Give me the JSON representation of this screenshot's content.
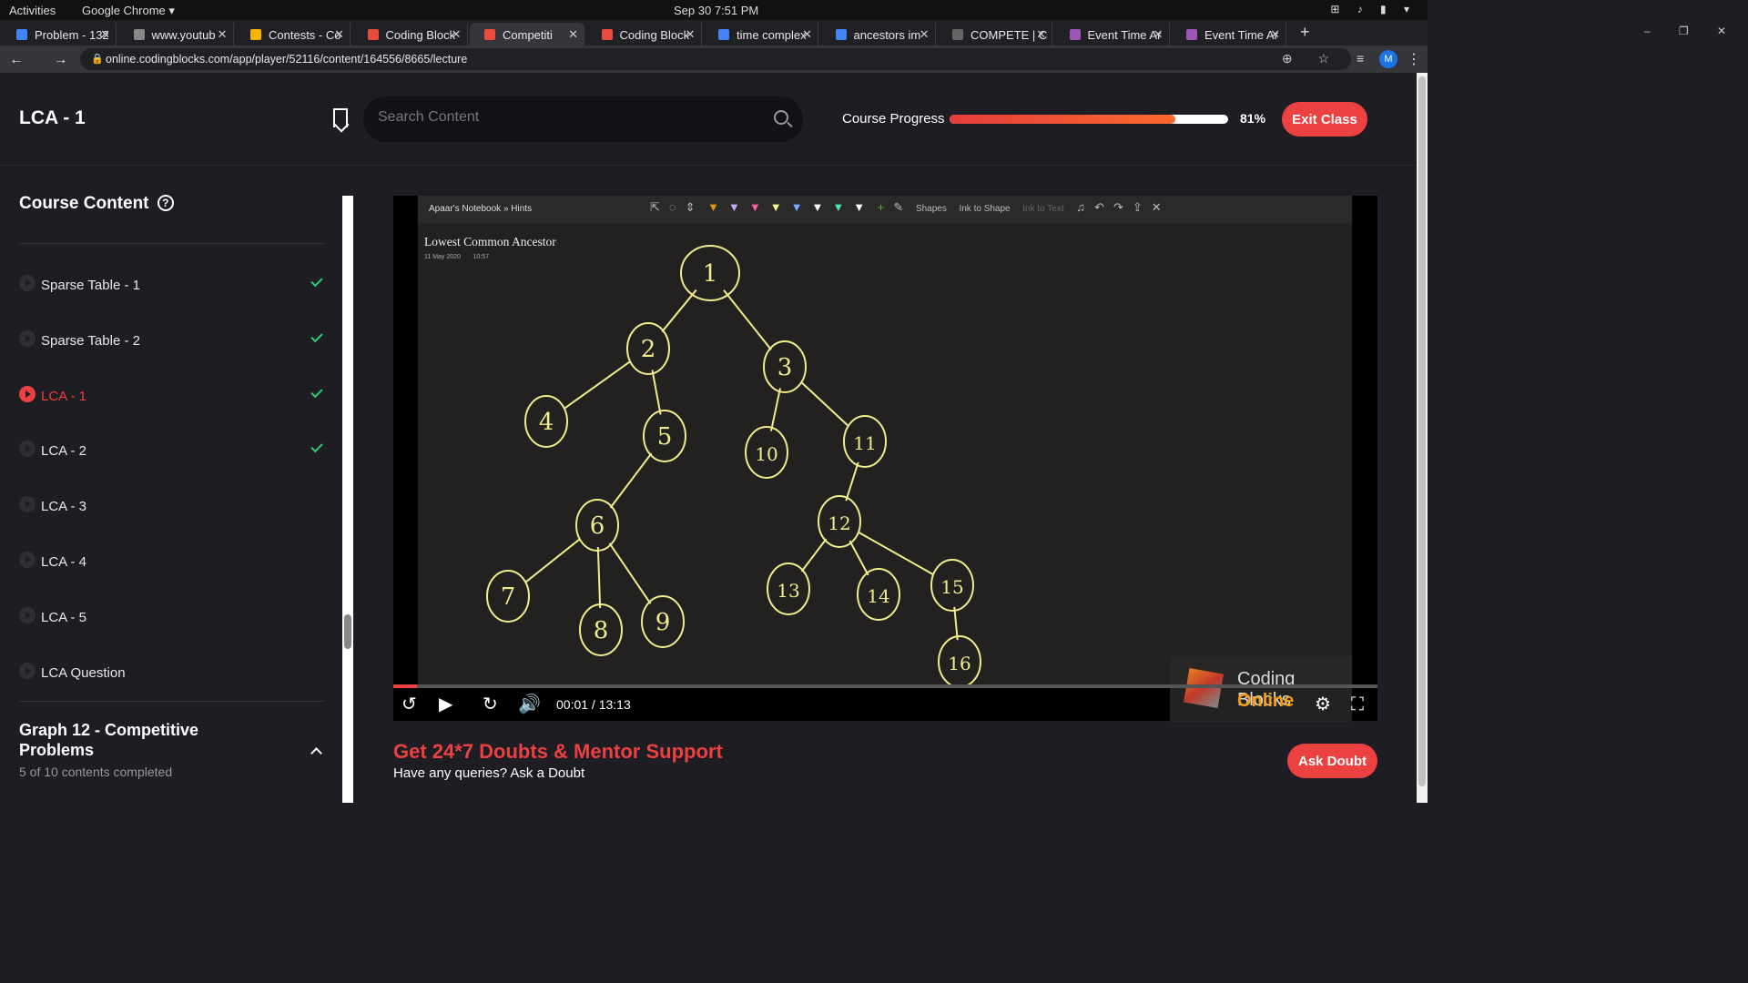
{
  "os": {
    "activities": "Activities",
    "app": "Google Chrome ▾",
    "clock": "Sep 30  7:51 PM"
  },
  "tabs": [
    {
      "label": "Problem - 132",
      "color": "#4285f4"
    },
    {
      "label": "www.youtub",
      "color": "#888888"
    },
    {
      "label": "Contests - Co",
      "color": "#f4b400"
    },
    {
      "label": "Coding Block",
      "color": "#e74c3c"
    },
    {
      "label": "Competiti",
      "color": "#e74c3c",
      "active": true
    },
    {
      "label": "Coding Block",
      "color": "#e74c3c"
    },
    {
      "label": "time complex",
      "color": "#4285f4"
    },
    {
      "label": "ancestors im",
      "color": "#4285f4"
    },
    {
      "label": "COMPETE | C",
      "color": "#666666"
    },
    {
      "label": "Event Time Ar",
      "color": "#9b59b6"
    },
    {
      "label": "Event Time Ar",
      "color": "#9b59b6"
    }
  ],
  "browser": {
    "url": "online.codingblocks.com/app/player/52116/content/164556/8665/lecture",
    "avatar": "M"
  },
  "header": {
    "title": "LCA - 1",
    "search_placeholder": "Search Content",
    "progress_label": "Course Progress",
    "progress_value": 0.81,
    "progress_text": "81%",
    "exit_label": "Exit Class"
  },
  "sidebar": {
    "title": "Course Content",
    "items": [
      {
        "label": "Sparse Table - 1",
        "done": true,
        "active": false
      },
      {
        "label": "Sparse Table - 2",
        "done": true,
        "active": false
      },
      {
        "label": "LCA - 1",
        "done": true,
        "active": true
      },
      {
        "label": "LCA - 2",
        "done": true,
        "active": false
      },
      {
        "label": "LCA - 3",
        "done": false,
        "active": false
      },
      {
        "label": "LCA - 4",
        "done": false,
        "active": false
      },
      {
        "label": "LCA - 5",
        "done": false,
        "active": false
      },
      {
        "label": "LCA Question",
        "done": false,
        "active": false
      }
    ],
    "section_title": "Graph 12 - Competitive Problems",
    "section_sub": "5 of 10 contents completed"
  },
  "video": {
    "breadcrumb": "Apaar's Notebook » Hints",
    "tools": {
      "shapes": "Shapes",
      "ink_to_shape": "Ink to Shape",
      "ink_to_text": "Ink to Text"
    },
    "note_title": "Lowest Common Ancestor",
    "note_date": "11 May 2020",
    "note_time": "10:57",
    "tree_nodes": [
      "1",
      "2",
      "3",
      "4",
      "5",
      "6",
      "7",
      "8",
      "9",
      "10",
      "11",
      "12",
      "13",
      "14",
      "15",
      "16"
    ],
    "watermark_line1": "Coding Blocks",
    "watermark_line2": "Online",
    "time_text": "00:01 / 13:13",
    "played_fraction": 0.024
  },
  "cta": {
    "title": "Get 24*7 Doubts & Mentor Support",
    "subtitle": "Have any queries? Ask a Doubt",
    "button": "Ask Doubt"
  }
}
